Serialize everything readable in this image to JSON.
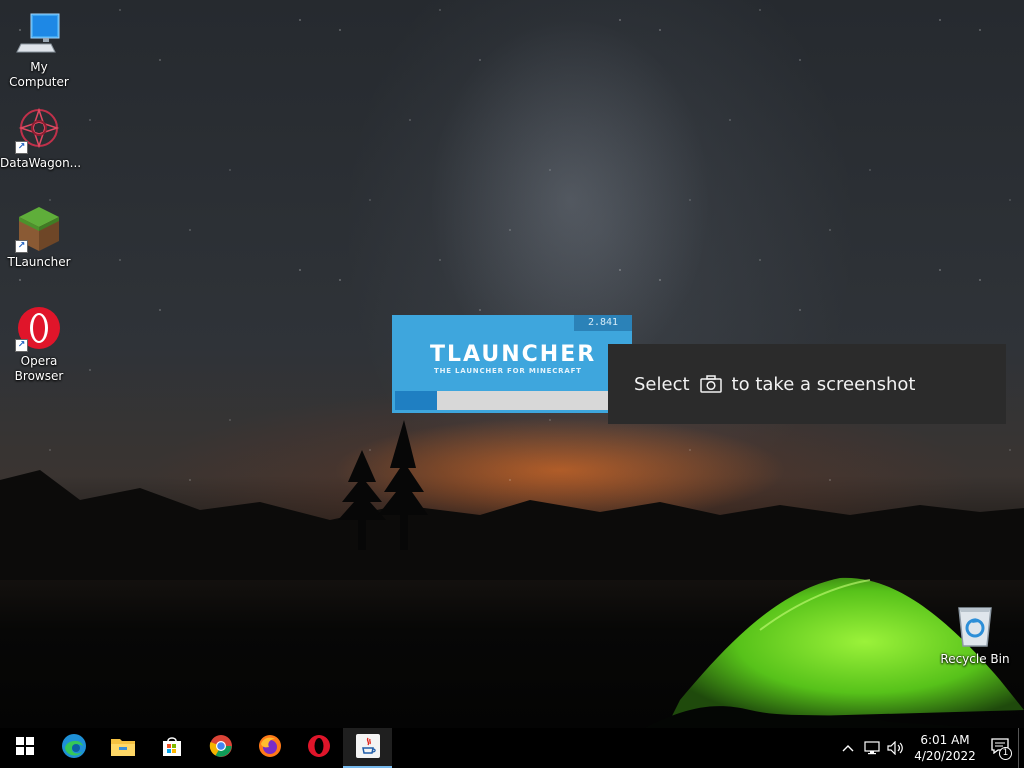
{
  "desktop": {
    "icons": [
      {
        "label": "My Computer",
        "icon": "computer-icon",
        "shortcut": false
      },
      {
        "label": "DataWagon...",
        "icon": "datawagon-icon",
        "shortcut": true
      },
      {
        "label": "TLauncher",
        "icon": "tlauncher-grass-block-icon",
        "shortcut": true
      },
      {
        "label": "Opera Browser",
        "icon": "opera-icon",
        "shortcut": true
      },
      {
        "label": "Recycle Bin",
        "icon": "recycle-bin-icon",
        "shortcut": false
      }
    ]
  },
  "splash": {
    "version": "2.841",
    "title": "TLAUNCHER",
    "subtitle": "THE LAUNCHER FOR MINECRAFT",
    "progress_fraction": 0.18,
    "accent": "#3ea6dd"
  },
  "toast": {
    "before": "Select",
    "after": "to take a screenshot",
    "icon": "camera-icon"
  },
  "taskbar": {
    "buttons": [
      {
        "name": "start-button",
        "icon": "windows-logo-icon"
      },
      {
        "name": "edge-button",
        "icon": "edge-icon"
      },
      {
        "name": "file-explorer-button",
        "icon": "folder-icon"
      },
      {
        "name": "store-button",
        "icon": "store-icon"
      },
      {
        "name": "chrome-button",
        "icon": "chrome-icon"
      },
      {
        "name": "firefox-button",
        "icon": "firefox-icon"
      },
      {
        "name": "opera-button",
        "icon": "opera-icon"
      },
      {
        "name": "java-button",
        "icon": "java-icon",
        "active": true
      }
    ],
    "tray": {
      "time": "6:01 AM",
      "date": "4/20/2022",
      "notification_count": "1"
    }
  }
}
